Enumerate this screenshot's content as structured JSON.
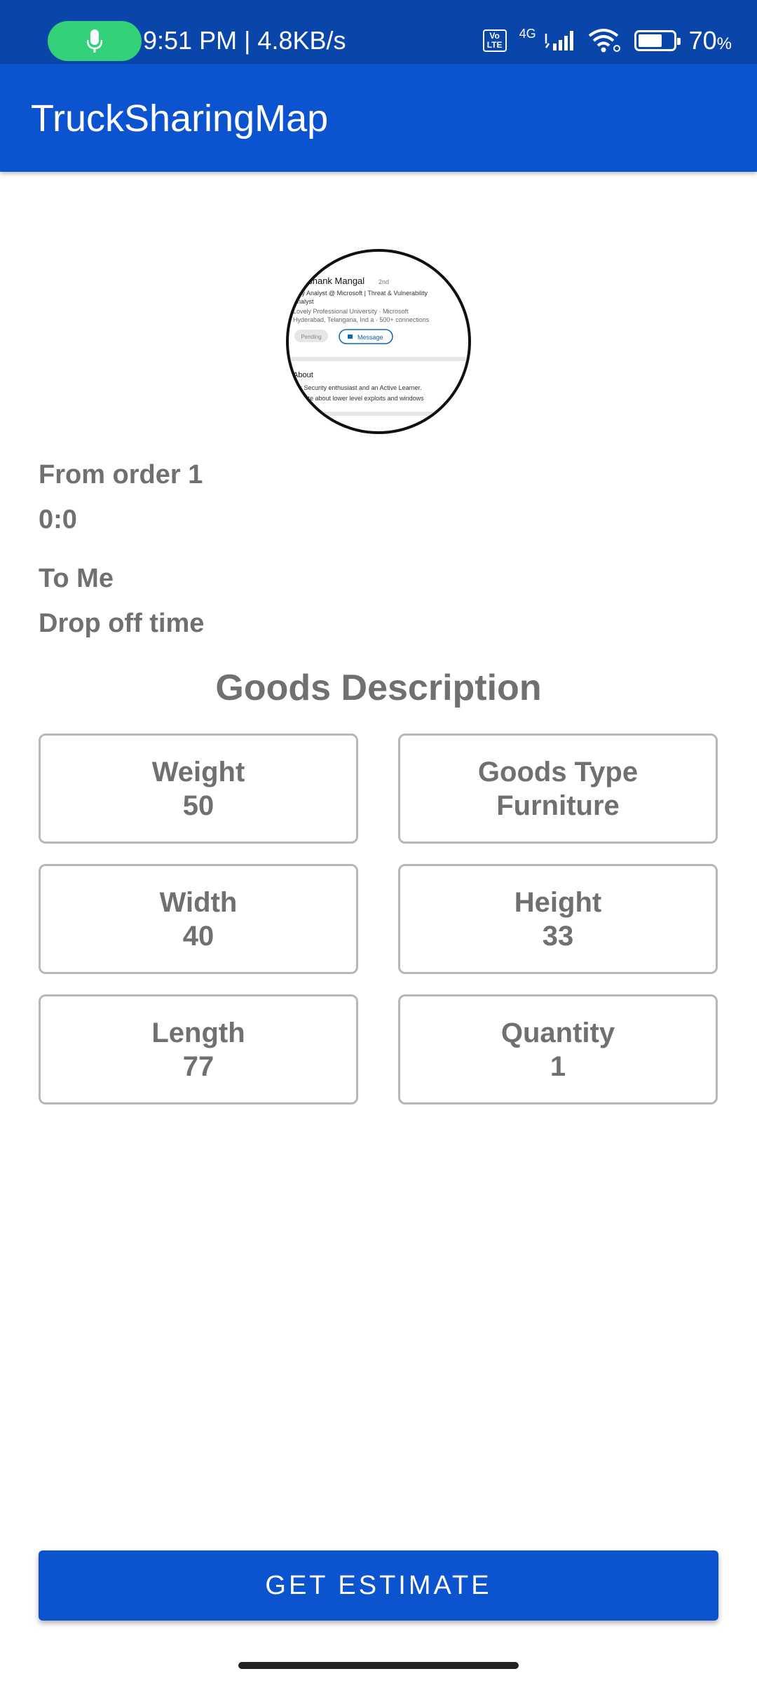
{
  "status_bar": {
    "time_speed": "9:51 PM | 4.8KB/s",
    "volte_label": "Vo\nLTE",
    "network": "4G",
    "battery_percent": "70",
    "battery_unit": "%",
    "battery_level": 0.7,
    "icons": [
      "mic-icon",
      "volte-icon",
      "signal-icon",
      "wifi-icon",
      "battery-icon"
    ],
    "accent_color": "#33d17a",
    "bg_color": "#0a46aa"
  },
  "app_bar": {
    "title": "TruckSharingMap",
    "bg_color": "#0b53cf"
  },
  "profile_image": {
    "name": "ashank Mangal",
    "degree": "2nd",
    "headline_line1": "urity Analyst @ Microsoft | Threat & Vulnerability",
    "headline_line2": "Analyst",
    "education": "Lovely Professional University · Microsoft",
    "location": "Hyderabad, Telangana, Ind a · 500+ connections",
    "pending_label": "Pending",
    "message_label": "Message",
    "about_title": "About",
    "about_line1": "ber Security enthusiast and an Active Learner.",
    "about_line2": "sionate about lower level exploits and windows"
  },
  "order": {
    "from_label": "From order 1",
    "pickup_time": "0:0",
    "to_label": "To Me",
    "dropoff_label": "Drop off time"
  },
  "goods": {
    "section_title": "Goods Description",
    "items": [
      {
        "label": "Weight",
        "value": "50"
      },
      {
        "label": "Goods Type",
        "value": "Furniture"
      },
      {
        "label": "Width",
        "value": "40"
      },
      {
        "label": "Height",
        "value": "33"
      },
      {
        "label": "Length",
        "value": "77"
      },
      {
        "label": "Quantity",
        "value": "1"
      }
    ]
  },
  "actions": {
    "estimate_label": "GET ESTIMATE"
  }
}
